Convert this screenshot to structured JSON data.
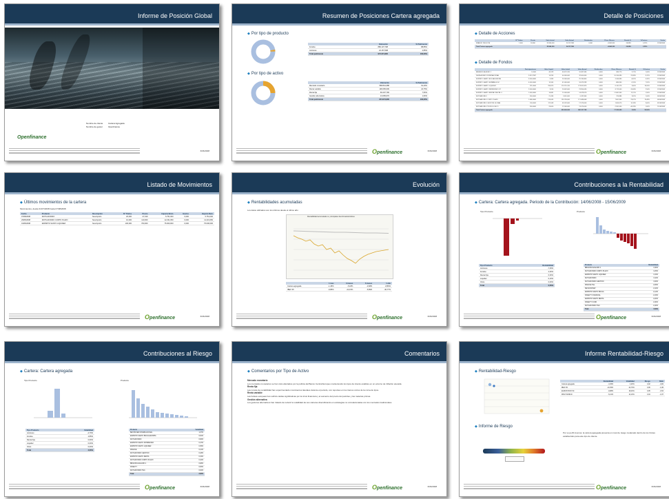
{
  "pages": {
    "p1": {
      "title": "Informe de Posición Global",
      "meta": [
        [
          "Nombre de cliente",
          "Cartera Agregada"
        ],
        [
          "Nombre de gestor",
          "Openfinance"
        ]
      ],
      "logo": "Openfinance",
      "page_no": "6/06/2008"
    },
    "p2": {
      "title": "Resumen de Posiciones Cartera agregada",
      "sec1": "Por tipo de producto",
      "sec2": "Por tipo de activo",
      "t1": {
        "headers": [
          "",
          "Valoración",
          "% Patrimonio"
        ],
        "rows": [
          [
            "Fondos",
            "880.107,798",
            "88,85%"
          ],
          [
            "Acciones",
            "24.157,598",
            "2,85%"
          ],
          [
            "Total patrimonio",
            "974.074,600",
            "100,00%"
          ]
        ]
      },
      "t2": {
        "headers": [
          "",
          "Valoración",
          "% Patrimonio"
        ],
        "rows": [
          [
            "Mercado monetario",
            "568.841,688",
            "61,20%"
          ],
          [
            "Renta variable",
            "196.065,609",
            "22,75%"
          ],
          [
            "Renta fija",
            "66.237,790",
            "7,50%"
          ],
          [
            "Gestión alternativa",
            "13.065,670",
            "1,60%"
          ],
          [
            "Total patrimonio",
            "974.074,600",
            "100,00%"
          ]
        ]
      },
      "donut1": {
        "segments": [
          {
            "label": "Fondos",
            "value": 97.5,
            "color": "#a9bfe0"
          },
          {
            "label": "Acciones",
            "value": 2.5,
            "color": "#e6a430"
          }
        ]
      },
      "donut2": {
        "segments": [
          {
            "label": "Mercado monetario",
            "value": 68,
            "color": "#a9bfe0"
          },
          {
            "label": "Renta variable",
            "value": 25,
            "color": "#e6a430"
          },
          {
            "label": "Renta fija",
            "value": 7,
            "color": "#a9bfe0"
          }
        ]
      },
      "page_no": "6/06/2008"
    },
    "p3": {
      "title": "Detalle de Posiciones",
      "sec1": "Detalle de Acciones",
      "sec2": "Detalle de Fondos",
      "t1": {
        "headers": [
          "",
          "Nº Títulos",
          "Precio",
          "Valor Inicial",
          "Valor Actual",
          "Dividendos",
          "Plusv. Minusv.",
          "Rentab %",
          "%Cartera",
          "Fecha"
        ],
        "rows": [
          [
            "FRANCE TELECOM",
            "1.000",
            "18,300",
            "20.940,000",
            "24.157,598",
            "0,000",
            "-4.840,300",
            "-16,88%",
            "4,23%",
            "12/06/2008"
          ],
          [
            "Total Cartera agregada",
            "",
            "",
            "28.940,000",
            "24.157,598",
            "",
            "-4.840,300",
            "-16,88%",
            "2,55%",
            ""
          ]
        ]
      },
      "t2": {
        "headers": [
          "",
          "Participaciones",
          "Valor Liquid.",
          "Valor Inicial",
          "Valor Actual",
          "Dividendos",
          "Plusv. Minusv.",
          "Rentab %",
          "%Cartera",
          "Fecha"
        ],
        "rows": [
          [
            "BBVA BOLSA EURO 1",
            "14.600",
            "46,129",
            "60.421,700",
            "10.087,580",
            "0,000",
            "680,770",
            "3,71%",
            "1,06%",
            "12/06/2008"
          ],
          [
            "DEXIA MONEY INTERNACIONAL",
            "3.012,2587",
            "14,256",
            "44.000,000",
            "32.000,600",
            "0,000",
            "10.100,690",
            "25,98%",
            "8,11%",
            "12/06/2008"
          ],
          [
            "ESPIRITO SANTO BOLSA EUROPA",
            "3.000,0000",
            "6,390",
            "20.000,000",
            "25.194,840",
            "0,000",
            "-1.540,990",
            "-6,81%",
            "4,32%",
            "12/06/2008"
          ],
          [
            "ESPIRITO SANTO ESPAÑA 00 SC",
            "4.000,0000",
            "16,104",
            "41.460,000",
            "16.673,299",
            "0,000",
            "-880,300",
            "-3,15%",
            "7,91%",
            "12/06/2008"
          ],
          [
            "ESPIRITO SANTO LIQUIDEZ",
            "221,6000",
            "760,870",
            "170.710,700",
            "173.812,876",
            "0,000",
            "6.141,276",
            "3,60%",
            "18,26%",
            "12/06/2008"
          ],
          [
            "ESPIRITO SANTO PATRIMONIO VZ",
            "2.000,0000",
            "9,240",
            "20.462,000",
            "23.954,090",
            "0,000",
            "-3.712,000",
            "-15,68%",
            "2,54%",
            "12/06/2008"
          ],
          [
            "ESPIRITO SANTO RENTA CRECIM. 0",
            "1.000,0000",
            "16,881",
            "11.600,000",
            "14.678,576",
            "0,000",
            "1.5341,300",
            "11,21%",
            "1,55%",
            "12/06/2008"
          ],
          [
            "MUTUAFONDO",
            "300,0000",
            "21,436",
            "5.610,000",
            "6.432,906",
            "0,000",
            "224,886",
            "3,81%",
            "1,04%",
            "06/06/2008"
          ],
          [
            "MUTUAFONDO CORTO PLAZO",
            "1.086,0000",
            "135,065",
            "155.790,000",
            "171.488,648",
            "0,000",
            "7.801,940",
            "23,07%",
            "19,48%",
            "06/06/2008"
          ],
          [
            "MUTUAFONDO GESTION GLOBAL",
            "100,0000",
            "117,049",
            "65.070,000",
            "17.070,000",
            "0,000",
            "1.600,570",
            "10,18%",
            "3,00%",
            "01/06/2008"
          ],
          [
            "MUTUAFONDO TECNOLOGICO",
            "300,0000",
            "24,000",
            "12.000,000",
            "13.070,000",
            "0,000",
            "-2.301,000",
            "-40,28%",
            "1,00%",
            "11/06/2008"
          ],
          [
            "Total Cartera agregada",
            "",
            "",
            "690.606,090",
            "800.107,798",
            "",
            "17.302,609",
            "2,56%",
            "99,50%",
            ""
          ]
        ]
      },
      "page_no": "6/06/2008"
    },
    "p4": {
      "title": "Listado de Movimientos",
      "sec1": "Últimos movimientos de la cartera",
      "subtitle": "Movimientos, desde 01/07/2008 hasta 07/08/2008",
      "t1": {
        "headers": [
          "Fecha",
          "Producto",
          "Descripción",
          "Nº Títulos",
          "Precio",
          "Importe Bruto",
          "Gastos",
          "Importe Neto"
        ],
        "rows": [
          [
            "07/08/2008",
            "MUTUAFONDO",
            "Suscripción",
            "20,000",
            "27,919",
            "5.751,000",
            "0,000",
            "5.751,000"
          ],
          [
            "29/05/2008",
            "MUTUAFONDO CORTO PLAZO",
            "Suscripción",
            "10,000",
            "110,000",
            "12.231,050",
            "0,000",
            "11.231,050"
          ],
          [
            "01/05/2008",
            "ESPIRITO SANTO LIQUIDEZ",
            "Suscripción",
            "100,000",
            "760,000",
            "75.000,000",
            "0,000",
            "75.000,000"
          ]
        ]
      },
      "page_no": "6/06/2008"
    },
    "p5": {
      "title": "Evolución",
      "sec1": "Rentabilidades acumuladas",
      "subtitle": "Los datos utilizados son los últimos desde el último año",
      "chart_caption": "Rentabilidad acumulada vs. principales benchmarks/índices",
      "t1": {
        "headers": [
          "",
          "1 mes",
          "3 meses",
          "6 meses",
          "1 año"
        ],
        "rows": [
          [
            "Cartera agregada",
            "-1,45%",
            "-5,18%",
            "-3,68%",
            "-8,89%"
          ],
          [
            "IBEX 35",
            "-9,85%",
            "-24,15%",
            "-5,89%",
            "-30,77%"
          ]
        ]
      },
      "page_no": "6/06/2008"
    },
    "p6": {
      "title": "Contribuciones a la Rentabilidad",
      "sec1": "Cartera: Cartera agregada. Periodo de la Contribución: 14/06/2008 - 15/06/2009",
      "lbl_left": "Tipo Producto",
      "lbl_right": "Producto",
      "t1": {
        "headers": [
          "Tipo Producto",
          "Rentabilidad"
        ],
        "rows": [
          [
            "Acciones",
            "-7,39%"
          ],
          [
            "Fondos",
            "2,30%"
          ],
          [
            "Renta Fija",
            "0,30%"
          ],
          [
            "Liquidez",
            "0,10%"
          ],
          [
            "Otros",
            "0,00%"
          ],
          [
            "Total",
            "0,56%"
          ]
        ]
      },
      "t2": {
        "headers": [
          "Producto",
          "Rentabilidad"
        ],
        "rows": [
          [
            "BBVA BOLSA EURO 1",
            "0,30%"
          ],
          [
            "MUTUAFONDO CORTO PLAZO",
            "0,25%"
          ],
          [
            "ESPIRITO SANTO LIQUIDEZ",
            "0,15%"
          ],
          [
            "MUTUAFONDO",
            "0,10%"
          ],
          [
            "MUTUAFONDO GESTION",
            "0,06%"
          ],
          [
            "FRANCE TEL.",
            "-0,05%"
          ],
          [
            "DEXIA MONEY",
            "-0,10%"
          ],
          [
            "ESPIRITO SANTO BOLSA",
            "-0,12%"
          ],
          [
            "FIDELITY FINANCIAL",
            "-0,15%"
          ],
          [
            "ESPIRITO SANTO RENTA",
            "-0,20%"
          ],
          [
            "FIDELITY FUND",
            "-0,30%"
          ],
          [
            "MUTUAFONDO TEC.",
            "-0,40%"
          ],
          [
            "Total",
            "0,56%"
          ]
        ]
      },
      "page_no": "6/06/2008"
    },
    "p7": {
      "title": "Contribuciones al Riesgo",
      "sec1": "Cartera: Cartera agregada",
      "lbl_left": "Tipo Producto",
      "lbl_right": "Producto",
      "t1": {
        "headers": [
          "Tipo Producto",
          "Volatilidad"
        ],
        "rows": [
          [
            "Acciones",
            "-2,79%"
          ],
          [
            "Fondos",
            "4,85%"
          ],
          [
            "Renta Fija",
            "0,60%"
          ],
          [
            "Liquidez",
            "0,00%"
          ],
          [
            "Otros",
            "0,00%"
          ],
          [
            "Total",
            "2,66%"
          ]
        ]
      },
      "t2": {
        "headers": [
          "Producto",
          "Volatilidad"
        ],
        "rows": [
          [
            "BESTINVER INTERNACIONAL",
            "1,07%"
          ],
          [
            "ESPIRITO SANTO BOLSA EUROPA",
            "0,81%"
          ],
          [
            "MUTUAFONDO",
            "0,66%"
          ],
          [
            "ESPIRITO SANTO PATRIMONIO",
            "0,47%"
          ],
          [
            "ESPIRITO SANTO LIQUIDEZ",
            "0,35%"
          ],
          [
            "FRANCE",
            "0,21%"
          ],
          [
            "MUTUAFONDO GESTION",
            "0,18%"
          ],
          [
            "ESPIRITO SANTO RENTA",
            "0,15%"
          ],
          [
            "MUTUAFONDO CORTO PLAZO",
            "0,10%"
          ],
          [
            "BBVA BOLSA EURO 1",
            "0,08%"
          ],
          [
            "FIDELITY",
            "0,05%"
          ],
          [
            "MUTUAFONDO TEC.",
            "0,02%"
          ],
          [
            "Total",
            "2,66%"
          ]
        ]
      },
      "page_no": "6/06/2008"
    },
    "p8": {
      "title": "Comentarios",
      "sec1": "Comentarios por Tipo de Activo",
      "paras": [
        {
          "head": "Mercado monetario",
          "body": "Los mercados monetarios se han visto afectados por la política del Banco Central Europeo manteniendo los tipos de interés estables en un entorno de inflación elevada."
        },
        {
          "head": "Renta fija",
          "body": "Las curvas de rentabilidad han experimentado movimientos laterales durante el periodo, con repuntes en los tramos cortos de la curva de tipos."
        },
        {
          "head": "Renta variable",
          "body": "Las bolsas europeas han sufrido caídas significativas por la crisis financiera y el aumento del precio del petróleo y las materias primas."
        },
        {
          "head": "Gestión alternativa",
          "body": "Los gestores alternativos han tratado de reducir la volatilidad de sus carteras diversificando en estrategias no correlacionadas con los mercados tradicionales."
        }
      ],
      "page_no": "6/06/2008"
    },
    "p9": {
      "title": "Informe Rentabilidad-Riesgo",
      "sec1": "Rentabilidad-Riesgo",
      "sec2": "Informe de Riesgo",
      "t1": {
        "headers": [
          "",
          "Rentabilidad",
          "Volatilidad",
          "Riesgo",
          "Ratio"
        ],
        "rows": [
          [
            "Cartera agregada",
            "-3,45%",
            "4,20%",
            "0,02",
            "-0,82"
          ],
          [
            "IBEX 35",
            "-10,35%",
            "22,70%",
            "0,06",
            "-0,45"
          ],
          [
            "EUROSTOXX 50",
            "-9,88%",
            "18,40%",
            "0,05",
            "-0,54"
          ],
          [
            "MSCI WORLD",
            "-5,21%",
            "14,10%",
            "0,04",
            "-0,37"
          ]
        ]
      },
      "note": "Por su perfil inversor, la cartera agregada presenta un nivel de riesgo moderado dentro de los límites establecidos para este tipo de cliente.",
      "page_no": "6/06/2008"
    }
  },
  "colors": {
    "header": "#1b3a57",
    "accent": "#1d7fbf",
    "bar_red": "#a4131c",
    "bar_blue": "#a9bfe0",
    "orange": "#e6a430"
  }
}
